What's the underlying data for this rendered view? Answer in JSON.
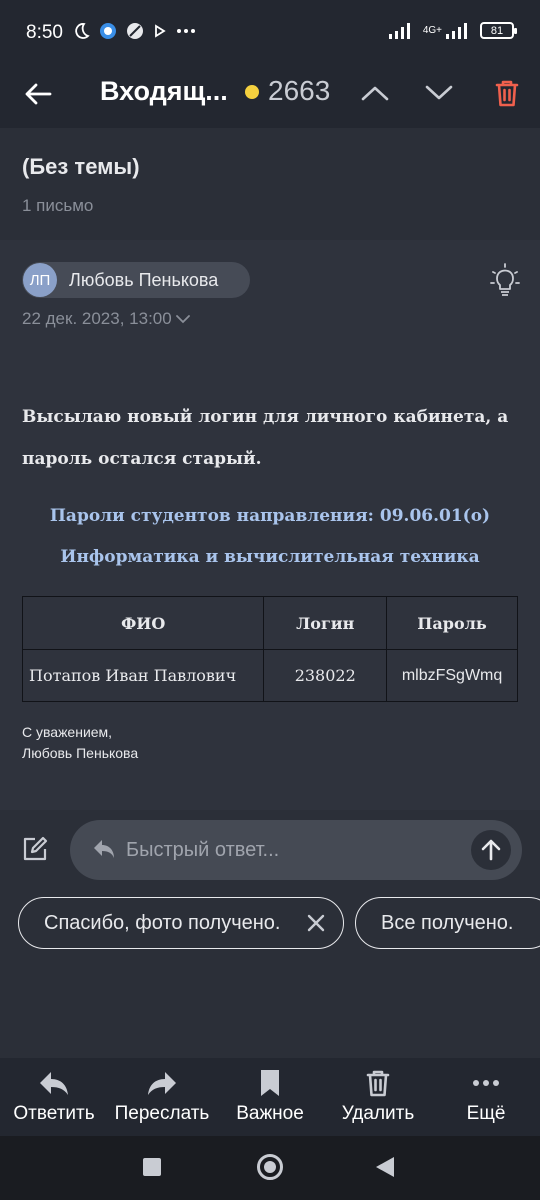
{
  "status_bar": {
    "time": "8:50",
    "network": "4G+",
    "battery": "81"
  },
  "app_bar": {
    "folder_title": "Входящ...",
    "unread_count": "2663",
    "unread_dot_color": "#f4d03f",
    "trash_color": "#f0604d",
    "icons": [
      "back-arrow-icon",
      "chevron-up-icon",
      "chevron-down-icon",
      "trash-icon"
    ]
  },
  "thread": {
    "subject": "(Без темы)",
    "letter_count": "1 письмо"
  },
  "message": {
    "avatar_initials": "ЛП",
    "sender_name": "Любовь Пенькова",
    "date": "22 дек. 2023, 13:00",
    "body_line1": "Высылаю новый логин для личного кабинета, а",
    "body_line2": "пароль остался старый.",
    "heading1": "Пароли студентов направления: 09.06.01(о)",
    "heading2": "Информатика и вычислительная техника",
    "heading_color": "#a9c4ec",
    "table": {
      "headers": [
        "ФИО",
        "Логин",
        "Пароль"
      ],
      "rows": [
        [
          "Потапов Иван Павлович",
          "238022",
          "mlbzFSgWmq"
        ]
      ]
    },
    "signature_line1": "С уважением,",
    "signature_line2": "Любовь Пенькова"
  },
  "quick_reply": {
    "placeholder": "Быстрый ответ..."
  },
  "suggestions": [
    "Спасибо, фото получено.",
    "Все получено."
  ],
  "bottom_actions": [
    {
      "label": "Ответить",
      "icon": "reply-icon"
    },
    {
      "label": "Переслать",
      "icon": "forward-icon"
    },
    {
      "label": "Важное",
      "icon": "bookmark-icon"
    },
    {
      "label": "Удалить",
      "icon": "trash-icon"
    },
    {
      "label": "Ещё",
      "icon": "more-dots-icon"
    }
  ]
}
